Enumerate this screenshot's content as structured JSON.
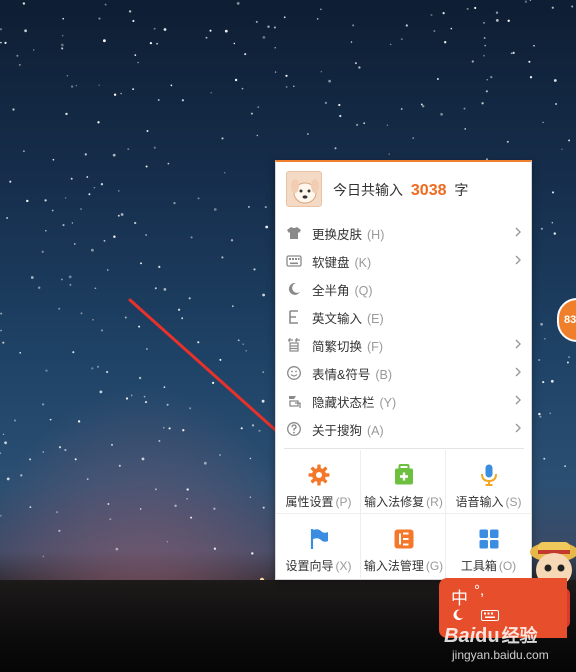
{
  "menu": {
    "header": {
      "prefix": "今日共输入",
      "count": "3038",
      "suffix": "字"
    },
    "items": [
      {
        "label": "更换皮肤",
        "key": "(H)",
        "icon": "shirt-icon",
        "submenu": true
      },
      {
        "label": "软键盘",
        "key": "(K)",
        "icon": "keyboard-icon",
        "submenu": true
      },
      {
        "label": "全半角",
        "key": "(Q)",
        "icon": "moon-icon",
        "submenu": false
      },
      {
        "label": "英文输入",
        "key": "(E)",
        "icon": "letter-e-icon",
        "submenu": false
      },
      {
        "label": "简繁切换",
        "key": "(F)",
        "icon": "simplified-char-icon",
        "submenu": true
      },
      {
        "label": "表情&符号",
        "key": "(B)",
        "icon": "smiley-icon",
        "submenu": true
      },
      {
        "label": "隐藏状态栏",
        "key": "(Y)",
        "icon": "hide-statusbar-icon",
        "submenu": true
      },
      {
        "label": "关于搜狗",
        "key": "(A)",
        "icon": "question-icon",
        "submenu": true
      }
    ],
    "grid": [
      {
        "label": "属性设置",
        "key": "(P)",
        "icon": "gear-icon",
        "color": "#f5772a"
      },
      {
        "label": "输入法修复",
        "key": "(R)",
        "icon": "repair-kit-icon",
        "color": "#6cbf3f"
      },
      {
        "label": "语音输入",
        "key": "(S)",
        "icon": "microphone-icon",
        "color": "#3a8de0"
      },
      {
        "label": "设置向导",
        "key": "(X)",
        "icon": "flag-icon",
        "color": "#3a8de0"
      },
      {
        "label": "输入法管理",
        "key": "(G)",
        "icon": "manager-icon",
        "color": "#f5772a"
      },
      {
        "label": "工具箱",
        "key": "(O)",
        "icon": "toolbox-icon",
        "color": "#3a8de0"
      }
    ]
  },
  "side_badge": "83",
  "ime_bar": {
    "mode": "中",
    "punct": "°,"
  },
  "watermark": {
    "brand_latin": "Bai",
    "brand_paw": "du",
    "brand_cn": "经验",
    "url": "jingyan.baidu.com"
  },
  "colors": {
    "accent": "#f06a1e",
    "arrow": "#e8312b"
  }
}
